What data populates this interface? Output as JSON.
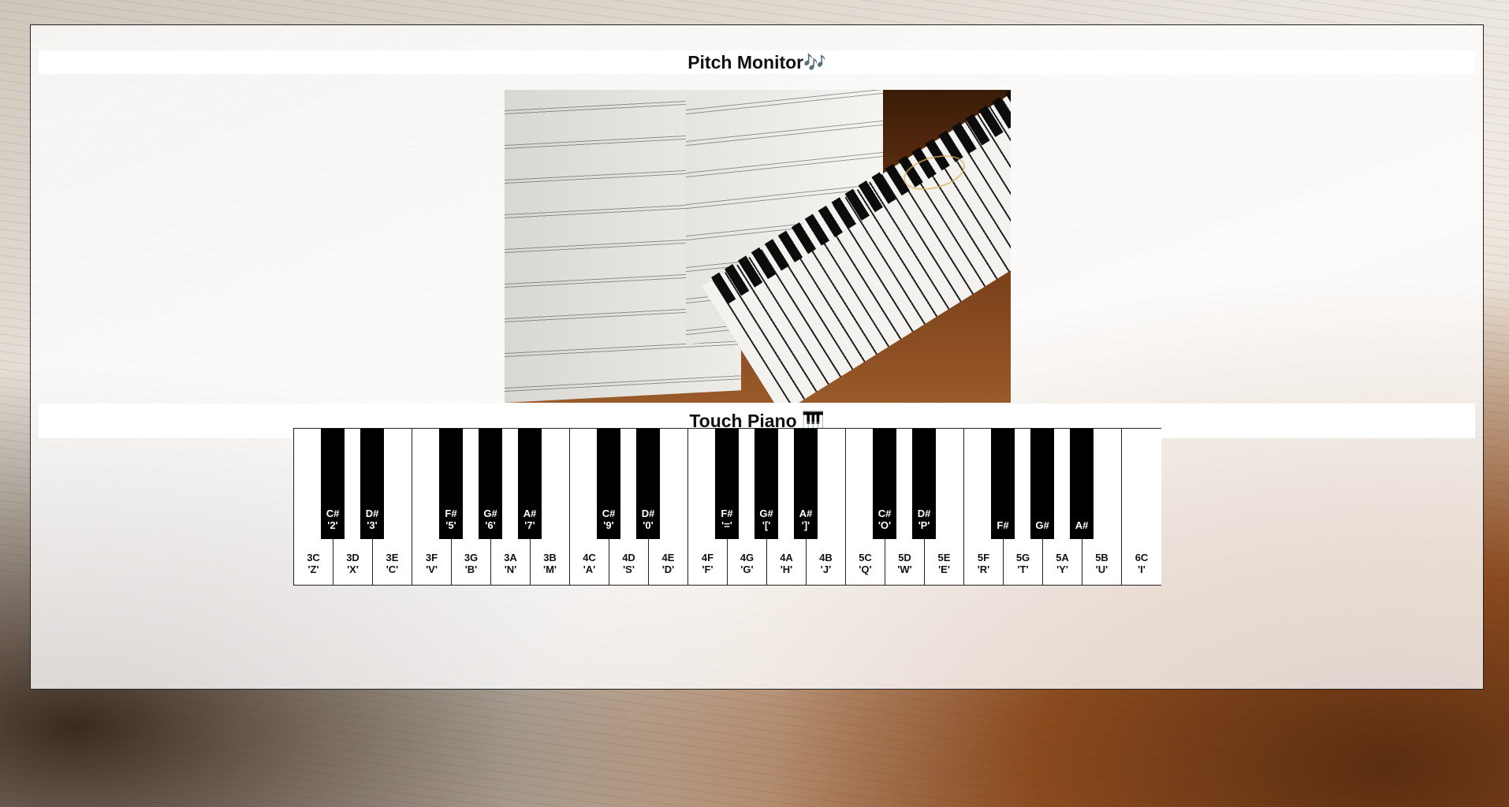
{
  "pitch_monitor": {
    "title": "Pitch Monitor🎶"
  },
  "touch_piano": {
    "title": "Touch Piano 🎹"
  },
  "piano": {
    "white_keys": [
      {
        "note": "3C",
        "key": "'Z'"
      },
      {
        "note": "3D",
        "key": "'X'"
      },
      {
        "note": "3E",
        "key": "'C'"
      },
      {
        "note": "3F",
        "key": "'V'"
      },
      {
        "note": "3G",
        "key": "'B'"
      },
      {
        "note": "3A",
        "key": "'N'"
      },
      {
        "note": "3B",
        "key": "'M'"
      },
      {
        "note": "4C",
        "key": "'A'"
      },
      {
        "note": "4D",
        "key": "'S'"
      },
      {
        "note": "4E",
        "key": "'D'"
      },
      {
        "note": "4F",
        "key": "'F'"
      },
      {
        "note": "4G",
        "key": "'G'"
      },
      {
        "note": "4A",
        "key": "'H'"
      },
      {
        "note": "4B",
        "key": "'J'"
      },
      {
        "note": "5C",
        "key": "'Q'"
      },
      {
        "note": "5D",
        "key": "'W'"
      },
      {
        "note": "5E",
        "key": "'E'"
      },
      {
        "note": "5F",
        "key": "'R'"
      },
      {
        "note": "5G",
        "key": "'T'"
      },
      {
        "note": "5A",
        "key": "'Y'"
      },
      {
        "note": "5B",
        "key": "'U'"
      },
      {
        "note": "6C",
        "key": "'I'"
      }
    ],
    "black_keys": [
      {
        "note": "C#",
        "key": "'2'"
      },
      {
        "note": "D#",
        "key": "'3'"
      },
      {
        "note": "F#",
        "key": "'5'"
      },
      {
        "note": "G#",
        "key": "'6'"
      },
      {
        "note": "A#",
        "key": "'7'"
      },
      {
        "note": "C#",
        "key": "'9'"
      },
      {
        "note": "D#",
        "key": "'0'"
      },
      {
        "note": "F#",
        "key": "'='"
      },
      {
        "note": "G#",
        "key": "'['"
      },
      {
        "note": "A#",
        "key": "']'"
      },
      {
        "note": "C#",
        "key": "'O'"
      },
      {
        "note": "D#",
        "key": "'P'"
      },
      {
        "note": "F#",
        "key": ""
      },
      {
        "note": "G#",
        "key": ""
      },
      {
        "note": "A#",
        "key": ""
      }
    ]
  }
}
